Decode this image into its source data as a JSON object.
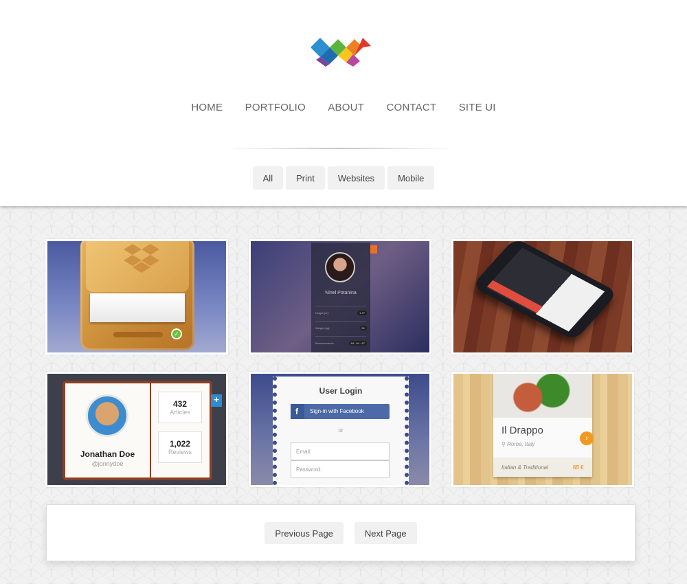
{
  "brand": {
    "stripe_colors": [
      "#b8479e",
      "#2b8fcf",
      "#f07f21",
      "#f5c71b",
      "#5cb43f",
      "#de3a2a"
    ],
    "logo_colors": [
      "#2c8fd1",
      "#1f6cb0",
      "#5cb43f",
      "#f5c71b",
      "#f07f21",
      "#de3a2a",
      "#b8479e",
      "#7a46a0"
    ]
  },
  "nav": {
    "items": [
      "HOME",
      "PORTFOLIO",
      "ABOUT",
      "CONTACT",
      "SITE UI"
    ]
  },
  "filters": [
    "All",
    "Print",
    "Websites",
    "Mobile"
  ],
  "portfolio": {
    "profile_tile": {
      "name": "Ninel Potanina",
      "rows": [
        {
          "label": "Height (m):",
          "value": "1.77"
        },
        {
          "label": "Weight (kg):",
          "value": "51"
        },
        {
          "label": "Measurements:",
          "value": "84 - 64 - 87"
        }
      ]
    },
    "book_tile": {
      "name": "Jonathan Doe",
      "username": "@jonnydoe",
      "stats": [
        {
          "value": "432",
          "label": "Articles"
        },
        {
          "value": "1,022",
          "label": "Reviews"
        }
      ]
    },
    "login_tile": {
      "title": "User Login",
      "facebook_label": "Sign-in with Facebook",
      "or_text": "or",
      "email_placeholder": "Email:",
      "password_placeholder": "Password:"
    },
    "restaurant_tile": {
      "name": "Il Drappo",
      "location": "Rome, Italy",
      "category": "Italian & Traditional",
      "price": "65 €"
    }
  },
  "pagination": {
    "previous_label": "Previous Page",
    "next_label": "Next Page"
  }
}
